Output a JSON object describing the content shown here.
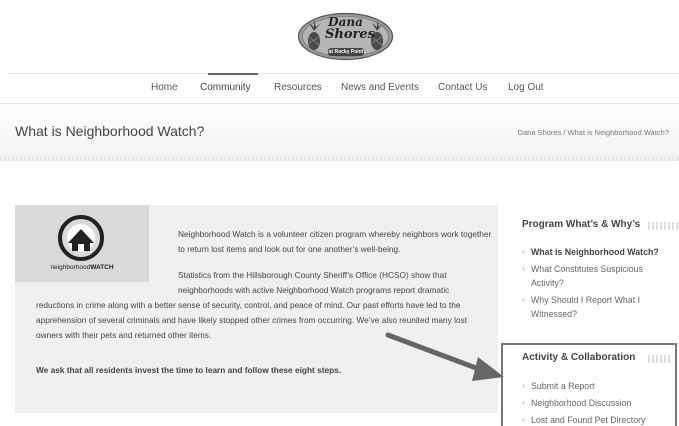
{
  "logo": {
    "line1": "Dana",
    "line2": "Shores",
    "line3": "at Rocky Point"
  },
  "nav": {
    "items": [
      {
        "label": "Home"
      },
      {
        "label": "Community"
      },
      {
        "label": "Resources"
      },
      {
        "label": "News and Events"
      },
      {
        "label": "Contact Us"
      },
      {
        "label": "Log Out"
      }
    ]
  },
  "page": {
    "title": "What is Neighborhood Watch?",
    "breadcrumb": "Dana Shores / What is Neighborhood Watch?"
  },
  "content": {
    "logo_text": "neighborhood",
    "logo_text_bold": "WATCH",
    "p1": "Neighborhood Watch is a volunteer citizen program whereby neighbors work together to return lost items and look out for one another’s well-being.",
    "p2_top": "Statistics from the Hillsborough County Sheriff’s Office (HCSO) show that neighborhoods with active Neighborhood Watch programs report dramatic",
    "p2_rest": "reductions in crime along with a better sense of security, control, and peace of mind. Our past efforts have led to the apprehension of several criminals and have likely stopped other crimes from occurring. We’ve also reunited many lost owners with their pets and returned other items.",
    "p3": "We ask that all residents invest the time to learn and follow these eight steps."
  },
  "sidebar": {
    "program_heading": "Program What’s & Why’s",
    "program_items": [
      {
        "label": "What is Neighborhood Watch?"
      },
      {
        "label": "What Constitutes Suspicious Activity?"
      },
      {
        "label": "Why Should I Report What I Witnessed?"
      }
    ],
    "activity_heading": "Activity & Collaboration",
    "activity_items": [
      {
        "label": "Submit a Report"
      },
      {
        "label": "Neighborhood Discussion"
      },
      {
        "label": "Lost and Found Pet Directory"
      }
    ],
    "chevron": "›"
  }
}
